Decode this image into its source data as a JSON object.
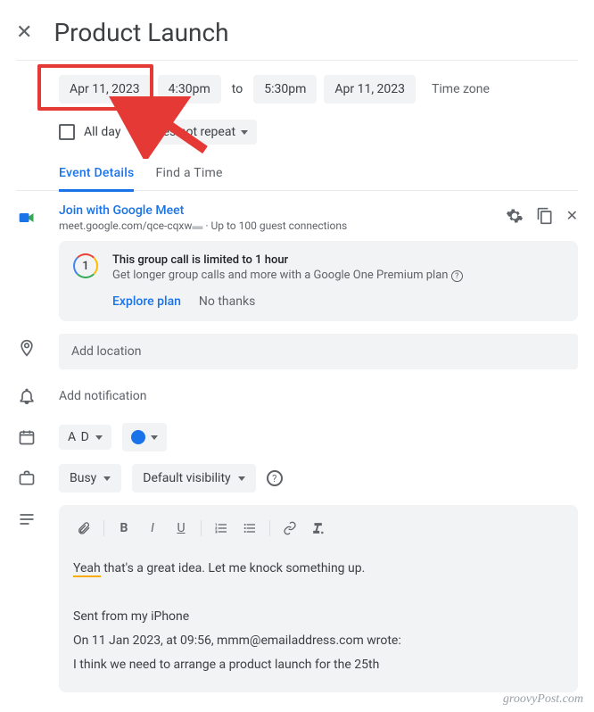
{
  "title": "Product Launch",
  "date_start": "Apr 11, 2023",
  "time_start": "4:30pm",
  "to_label": "to",
  "time_end": "5:30pm",
  "date_end": "Apr 11, 2023",
  "timezone_label": "Time zone",
  "all_day_label": "All day",
  "repeat_label": "Does not repeat",
  "tabs": {
    "details": "Event Details",
    "find_time": "Find a Time"
  },
  "meet": {
    "link_label": "Join with Google Meet",
    "url": "meet.google.com/qce-cqxw",
    "guest_info": "Up to 100 guest connections"
  },
  "g1": {
    "badge": "1",
    "title": "This group call is limited to 1 hour",
    "sub": "Get longer group calls and more with a Google One Premium plan",
    "explore": "Explore plan",
    "no_thanks": "No thanks"
  },
  "location_placeholder": "Add location",
  "notification_label": "Add notification",
  "calendar_name": "A D",
  "busy_label": "Busy",
  "visibility_label": "Default visibility",
  "description": {
    "yeah": "Yeah",
    "rest_line1": " that's a great idea. Let me knock something up.",
    "sent_from": "Sent from my iPhone",
    "quote_header": "On 11 Jan 2023, at 09:56, mmm@emailaddress.com wrote:",
    "quote_body": "I think we need to arrange a product launch for the 25th"
  },
  "watermark": "groovyPost.com"
}
